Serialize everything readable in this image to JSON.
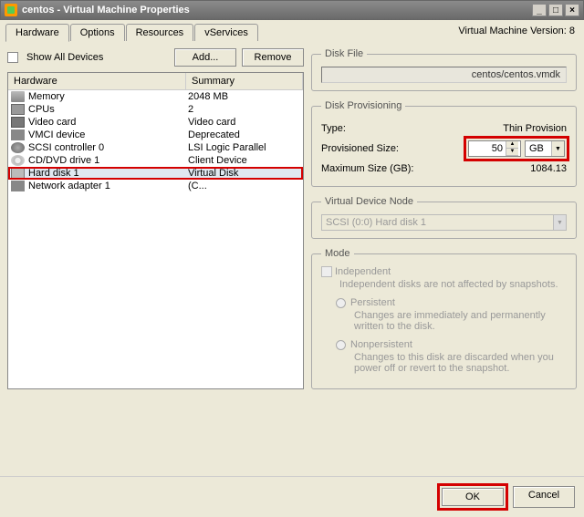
{
  "title": "centos - Virtual Machine Properties",
  "tabs": [
    "Hardware",
    "Options",
    "Resources",
    "vServices"
  ],
  "version": "Virtual Machine Version: 8",
  "showAll": "Show All Devices",
  "addBtn": "Add...",
  "removeBtn": "Remove",
  "cols": {
    "hw": "Hardware",
    "sum": "Summary"
  },
  "rows": [
    {
      "name": "Memory",
      "sum": "2048 MB"
    },
    {
      "name": "CPUs",
      "sum": "2"
    },
    {
      "name": "Video card",
      "sum": "Video card"
    },
    {
      "name": "VMCI device",
      "sum": "Deprecated"
    },
    {
      "name": "SCSI controller 0",
      "sum": "LSI Logic Parallel"
    },
    {
      "name": "CD/DVD drive 1",
      "sum": "Client Device"
    },
    {
      "name": "Hard disk 1",
      "sum": "Virtual Disk"
    },
    {
      "name": "Network adapter 1",
      "sum": "(C..."
    }
  ],
  "diskFile": {
    "legend": "Disk File",
    "value": "centos/centos.vmdk"
  },
  "prov": {
    "legend": "Disk Provisioning",
    "type": {
      "k": "Type:",
      "v": "Thin Provision"
    },
    "size": {
      "k": "Provisioned Size:",
      "v": "50",
      "unit": "GB"
    },
    "max": {
      "k": "Maximum Size (GB):",
      "v": "1084.13"
    }
  },
  "vnode": {
    "legend": "Virtual Device Node",
    "value": "SCSI (0:0) Hard disk 1"
  },
  "mode": {
    "legend": "Mode",
    "indep": "Independent",
    "indepDesc": "Independent disks are not affected by snapshots.",
    "pers": "Persistent",
    "persDesc": "Changes are immediately and permanently written to the disk.",
    "nonpers": "Nonpersistent",
    "nonpersDesc": "Changes to this disk are discarded when you power off or revert to the snapshot."
  },
  "ok": "OK",
  "cancel": "Cancel"
}
